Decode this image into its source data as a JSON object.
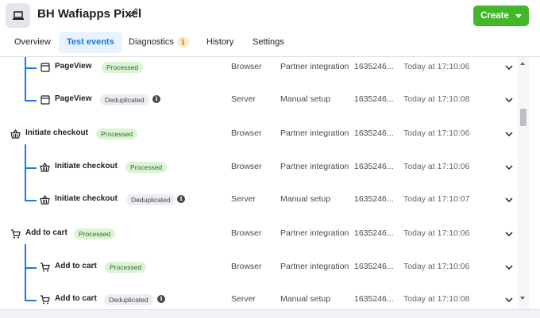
{
  "header": {
    "title": "BH Wafiapps Pixel",
    "create_label": "Create",
    "app_icon": "laptop-icon",
    "edit_icon": "pencil-icon"
  },
  "tabs": [
    {
      "label": "Overview",
      "active": false
    },
    {
      "label": "Test events",
      "active": true
    },
    {
      "label": "Diagnostics",
      "badge": "1",
      "active": false
    },
    {
      "label": "History",
      "active": false
    },
    {
      "label": "Settings",
      "active": false
    }
  ],
  "events": [
    {
      "name": "PageView",
      "status": "Processed",
      "source": "Browser",
      "setup": "Partner integration",
      "id": "1635246...",
      "time": "Today at 17:10:06",
      "icon": "page-icon",
      "child": true
    },
    {
      "name": "PageView",
      "status": "Deduplicated",
      "source": "Server",
      "setup": "Manual setup",
      "id": "1635246...",
      "time": "Today at 17:10:08",
      "icon": "page-icon",
      "child": true
    },
    {
      "name": "Initiate checkout",
      "status": "Processed",
      "source": "Browser",
      "setup": "Partner integration",
      "id": "1635246...",
      "time": "Today at 17:10:06",
      "icon": "basket-icon",
      "child": false
    },
    {
      "name": "Initiate checkout",
      "status": "Processed",
      "source": "Browser",
      "setup": "Partner integration",
      "id": "1635246...",
      "time": "Today at 17:10:06",
      "icon": "basket-icon",
      "child": true
    },
    {
      "name": "Initiate checkout",
      "status": "Deduplicated",
      "source": "Server",
      "setup": "Manual setup",
      "id": "1635246...",
      "time": "Today at 17:10:07",
      "icon": "basket-icon",
      "child": true
    },
    {
      "name": "Add to cart",
      "status": "Processed",
      "source": "Browser",
      "setup": "Partner integration",
      "id": "1635246...",
      "time": "Today at 17:10:06",
      "icon": "cart-icon",
      "child": false
    },
    {
      "name": "Add to cart",
      "status": "Processed",
      "source": "Browser",
      "setup": "Partner integration",
      "id": "1635246...",
      "time": "Today at 17:10:06",
      "icon": "cart-icon",
      "child": true
    },
    {
      "name": "Add to cart",
      "status": "Deduplicated",
      "source": "Server",
      "setup": "Manual setup",
      "id": "1635246...",
      "time": "Today at 17:10:08",
      "icon": "cart-icon",
      "child": true
    }
  ],
  "colors": {
    "accent": "#1877f2",
    "create_button": "#42b72a",
    "processed_badge": "#dcf4d6",
    "deduplicated_badge": "#ebedf0"
  }
}
